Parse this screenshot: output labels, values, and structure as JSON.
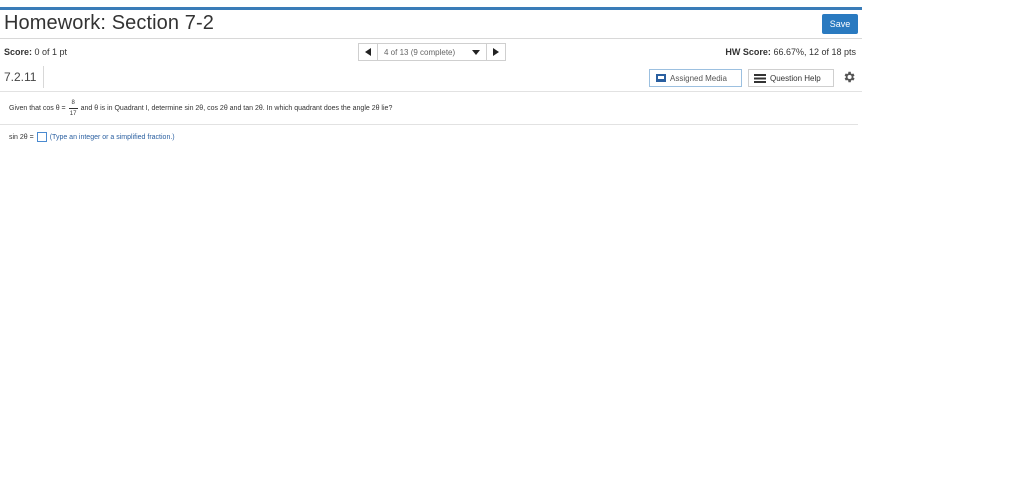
{
  "header": {
    "title": "Homework: Section 7-2",
    "save_label": "Save"
  },
  "score": {
    "label": "Score:",
    "value": "0 of 1 pt"
  },
  "navigation": {
    "position": "4 of 13 (9 complete)"
  },
  "hw_score": {
    "label": "HW Score:",
    "value": "66.67%, 12 of 18 pts"
  },
  "question_id": "7.2.11",
  "tools": {
    "assigned_media_label": "Assigned Media",
    "question_help_label": "Question Help"
  },
  "question": {
    "prefix": "Given that cos θ =",
    "numerator": "8",
    "denominator": "17",
    "suffix": "and θ is in Quadrant I, determine sin 2θ, cos 2θ and tan 2θ. In which quadrant does the angle 2θ lie?"
  },
  "answer": {
    "label": "sin 2θ =",
    "hint": "(Type an integer or a simplified fraction.)"
  },
  "icons": [
    "chevron-left-icon",
    "chevron-right-icon",
    "dropdown-icon",
    "media-icon",
    "list-icon",
    "gear-icon"
  ],
  "colors": {
    "accent": "#2a7ac0",
    "topline": "#3a7cb8"
  }
}
